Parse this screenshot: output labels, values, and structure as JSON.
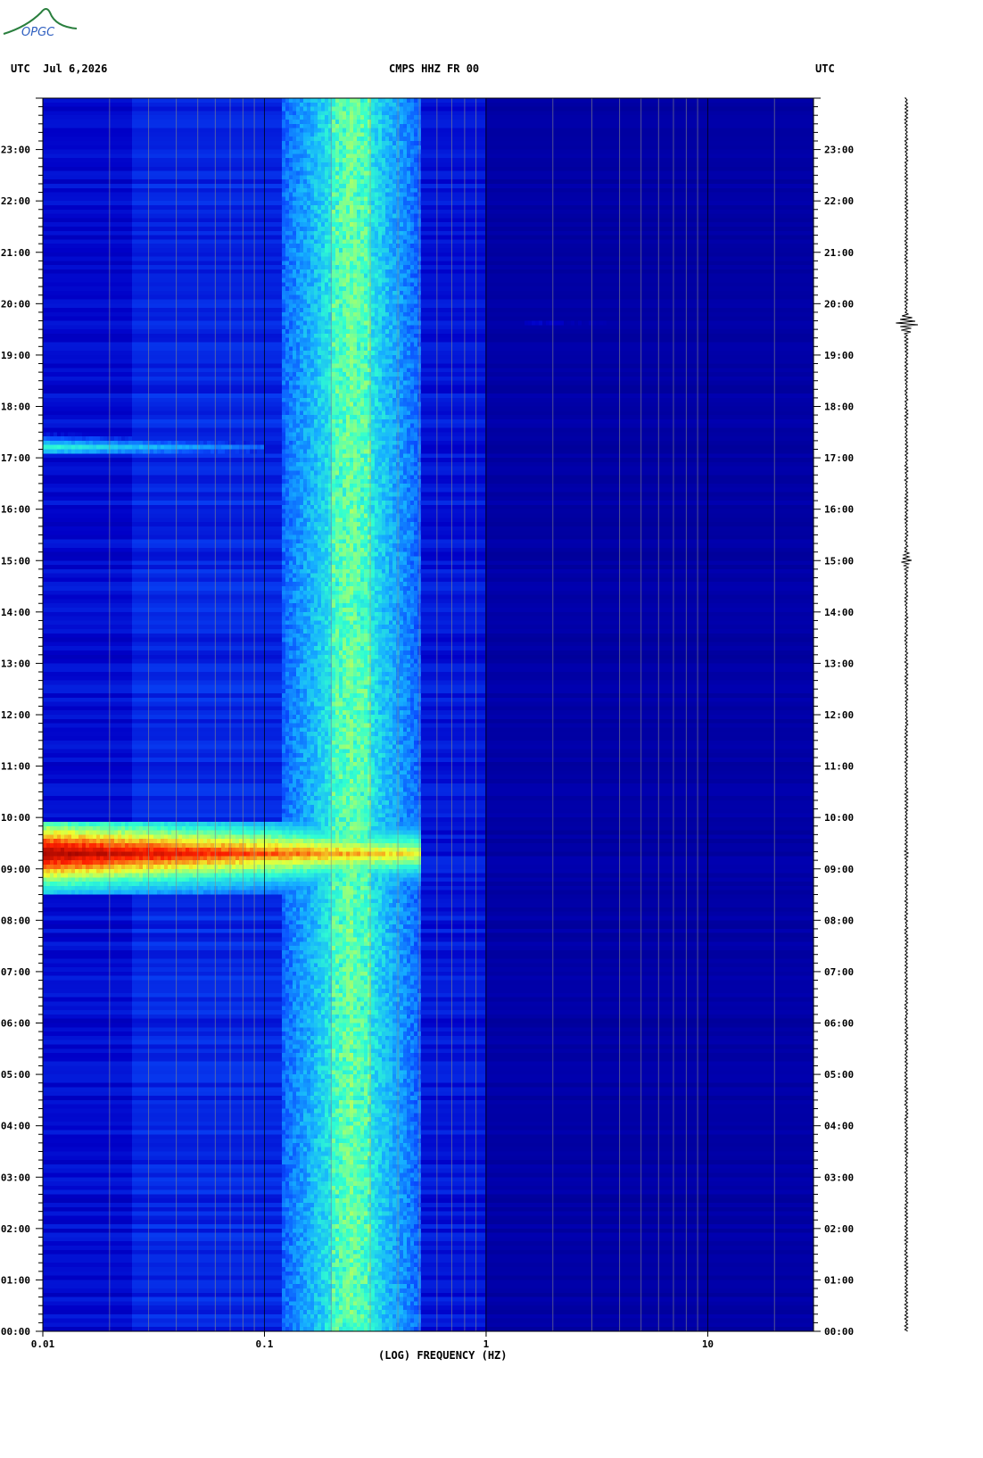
{
  "header": {
    "left": "UTC  Jul 6,2026",
    "center": "CMPS HHZ FR 00",
    "right": "UTC"
  },
  "logo": {
    "text": "OPGC",
    "color": "#2a7f3e"
  },
  "chart_data": {
    "type": "heatmap",
    "title": "CMPS HHZ FR 00",
    "xlabel": "(LOG) FREQUENCY (HZ)",
    "ylabel": "",
    "x_scale": "log",
    "xlim": [
      0.01,
      30
    ],
    "ylim_hours": [
      0,
      24
    ],
    "x_ticks": [
      {
        "value": 0.01,
        "label": "0.01"
      },
      {
        "value": 0.1,
        "label": "0.1"
      },
      {
        "value": 1,
        "label": "1"
      },
      {
        "value": 10,
        "label": "10"
      }
    ],
    "y_ticks": [
      {
        "value": 0,
        "label": "00:00"
      },
      {
        "value": 1,
        "label": "01:00"
      },
      {
        "value": 2,
        "label": "02:00"
      },
      {
        "value": 3,
        "label": "03:00"
      },
      {
        "value": 4,
        "label": "04:00"
      },
      {
        "value": 5,
        "label": "05:00"
      },
      {
        "value": 6,
        "label": "06:00"
      },
      {
        "value": 7,
        "label": "07:00"
      },
      {
        "value": 8,
        "label": "08:00"
      },
      {
        "value": 9,
        "label": "09:00"
      },
      {
        "value": 10,
        "label": "10:00"
      },
      {
        "value": 11,
        "label": "11:00"
      },
      {
        "value": 12,
        "label": "12:00"
      },
      {
        "value": 13,
        "label": "13:00"
      },
      {
        "value": 14,
        "label": "14:00"
      },
      {
        "value": 15,
        "label": "15:00"
      },
      {
        "value": 16,
        "label": "16:00"
      },
      {
        "value": 17,
        "label": "17:00"
      },
      {
        "value": 18,
        "label": "18:00"
      },
      {
        "value": 19,
        "label": "19:00"
      },
      {
        "value": 20,
        "label": "20:00"
      },
      {
        "value": 21,
        "label": "21:00"
      },
      {
        "value": 22,
        "label": "22:00"
      },
      {
        "value": 23,
        "label": "23:00"
      }
    ],
    "microseism_band_hz": [
      0.12,
      0.5
    ],
    "microseism_peak_hz": [
      0.2,
      0.3
    ],
    "events": [
      {
        "start_hour": 8.5,
        "end_hour": 9.9,
        "fmin_hz": 0.01,
        "fmax_hz": 0.5,
        "peak_hour": 9.3
      },
      {
        "start_hour": 17.1,
        "end_hour": 17.7,
        "fmin_hz": 0.01,
        "fmax_hz": 0.1,
        "peak_hour": 17.2
      },
      {
        "start_hour": 19.55,
        "end_hour": 19.65,
        "fmin_hz": 1.5,
        "fmax_hz": 30,
        "peak_hour": 19.6
      }
    ],
    "colormap": [
      "#00007a",
      "#0000c8",
      "#0a50ff",
      "#16b0ff",
      "#30ffd0",
      "#f0ff30",
      "#ff2000",
      "#8c0000"
    ],
    "trace_events": [
      {
        "hour": 19.6,
        "amplitude": 1.0
      },
      {
        "hour": 15.0,
        "amplitude": 0.5
      },
      {
        "hour": 9.3,
        "amplitude": 0.2
      }
    ]
  }
}
